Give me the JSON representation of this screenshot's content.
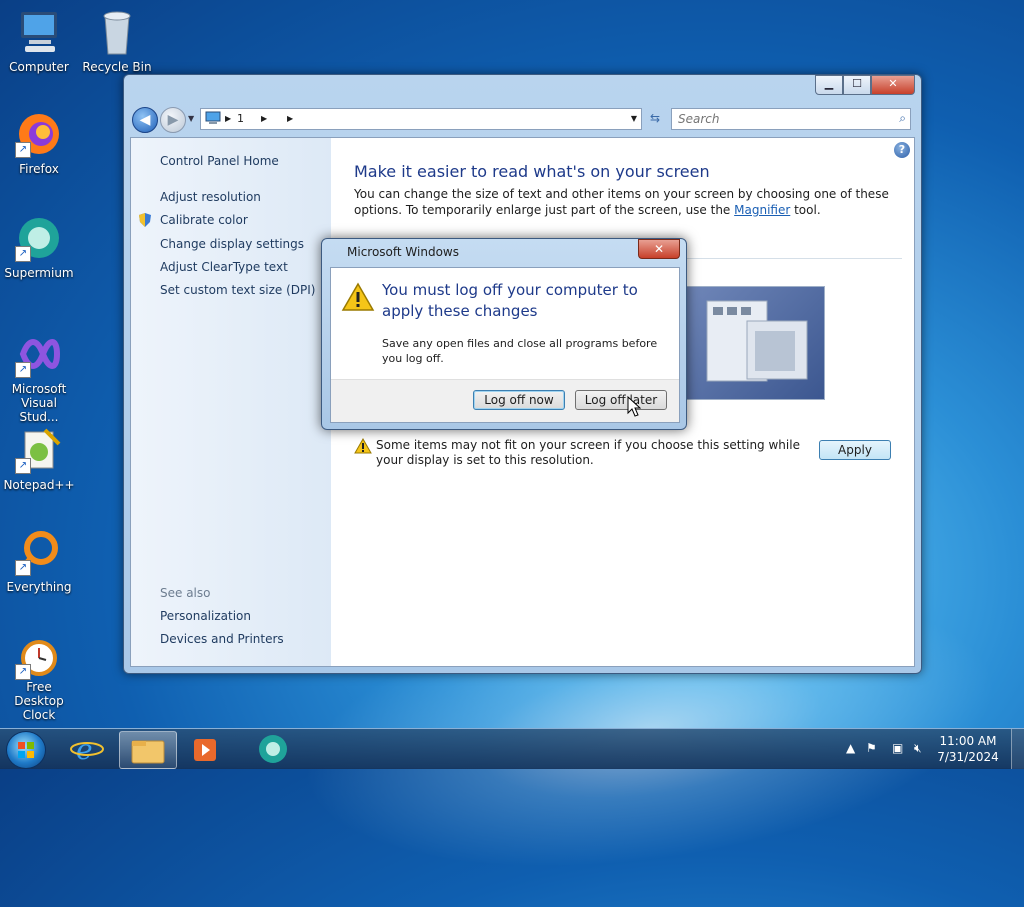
{
  "desktop": {
    "icons": [
      {
        "label": "Computer"
      },
      {
        "label": "Recycle Bin"
      },
      {
        "label": "Firefox"
      },
      {
        "label": "Supermium"
      },
      {
        "label": "Microsoft Visual Studio",
        "display": "Microsoft\nVisual Stud..."
      },
      {
        "label": "Notepad++"
      },
      {
        "label": "Everything"
      },
      {
        "label": "Free Desktop Clock",
        "display": "Free Desktop\nClock"
      }
    ]
  },
  "window": {
    "address": {
      "segment": "1"
    },
    "search": {
      "placeholder": "Search"
    },
    "sidebar": {
      "home": "Control Panel Home",
      "links": [
        "Adjust resolution",
        "Calibrate color",
        "Change display settings",
        "Adjust ClearType text",
        "Set custom text size (DPI)"
      ],
      "see_also": "See also",
      "see_also_links": [
        "Personalization",
        "Devices and Printers"
      ]
    },
    "main": {
      "heading": "Make it easier to read what's on your screen",
      "desc_before": "You can change the size of text and other items on your screen by choosing one of these options. To temporarily enlarge just part of the screen, use the ",
      "desc_link": "Magnifier",
      "desc_after": " tool.",
      "warning": "Some items may not fit on your screen if you choose this setting while your display is set to this resolution.",
      "apply": "Apply"
    }
  },
  "dialog": {
    "title": "Microsoft Windows",
    "close": "✕",
    "heading": "You must log off your computer to apply these changes",
    "text": "Save any open files and close all programs before you log off.",
    "btn_now": "Log off now",
    "btn_later": "Log off later"
  },
  "taskbar": {
    "time": "11:00 AM",
    "date": "7/31/2024"
  },
  "colors": {
    "accent": "#1e3a8a",
    "link": "#1a5fb4"
  }
}
